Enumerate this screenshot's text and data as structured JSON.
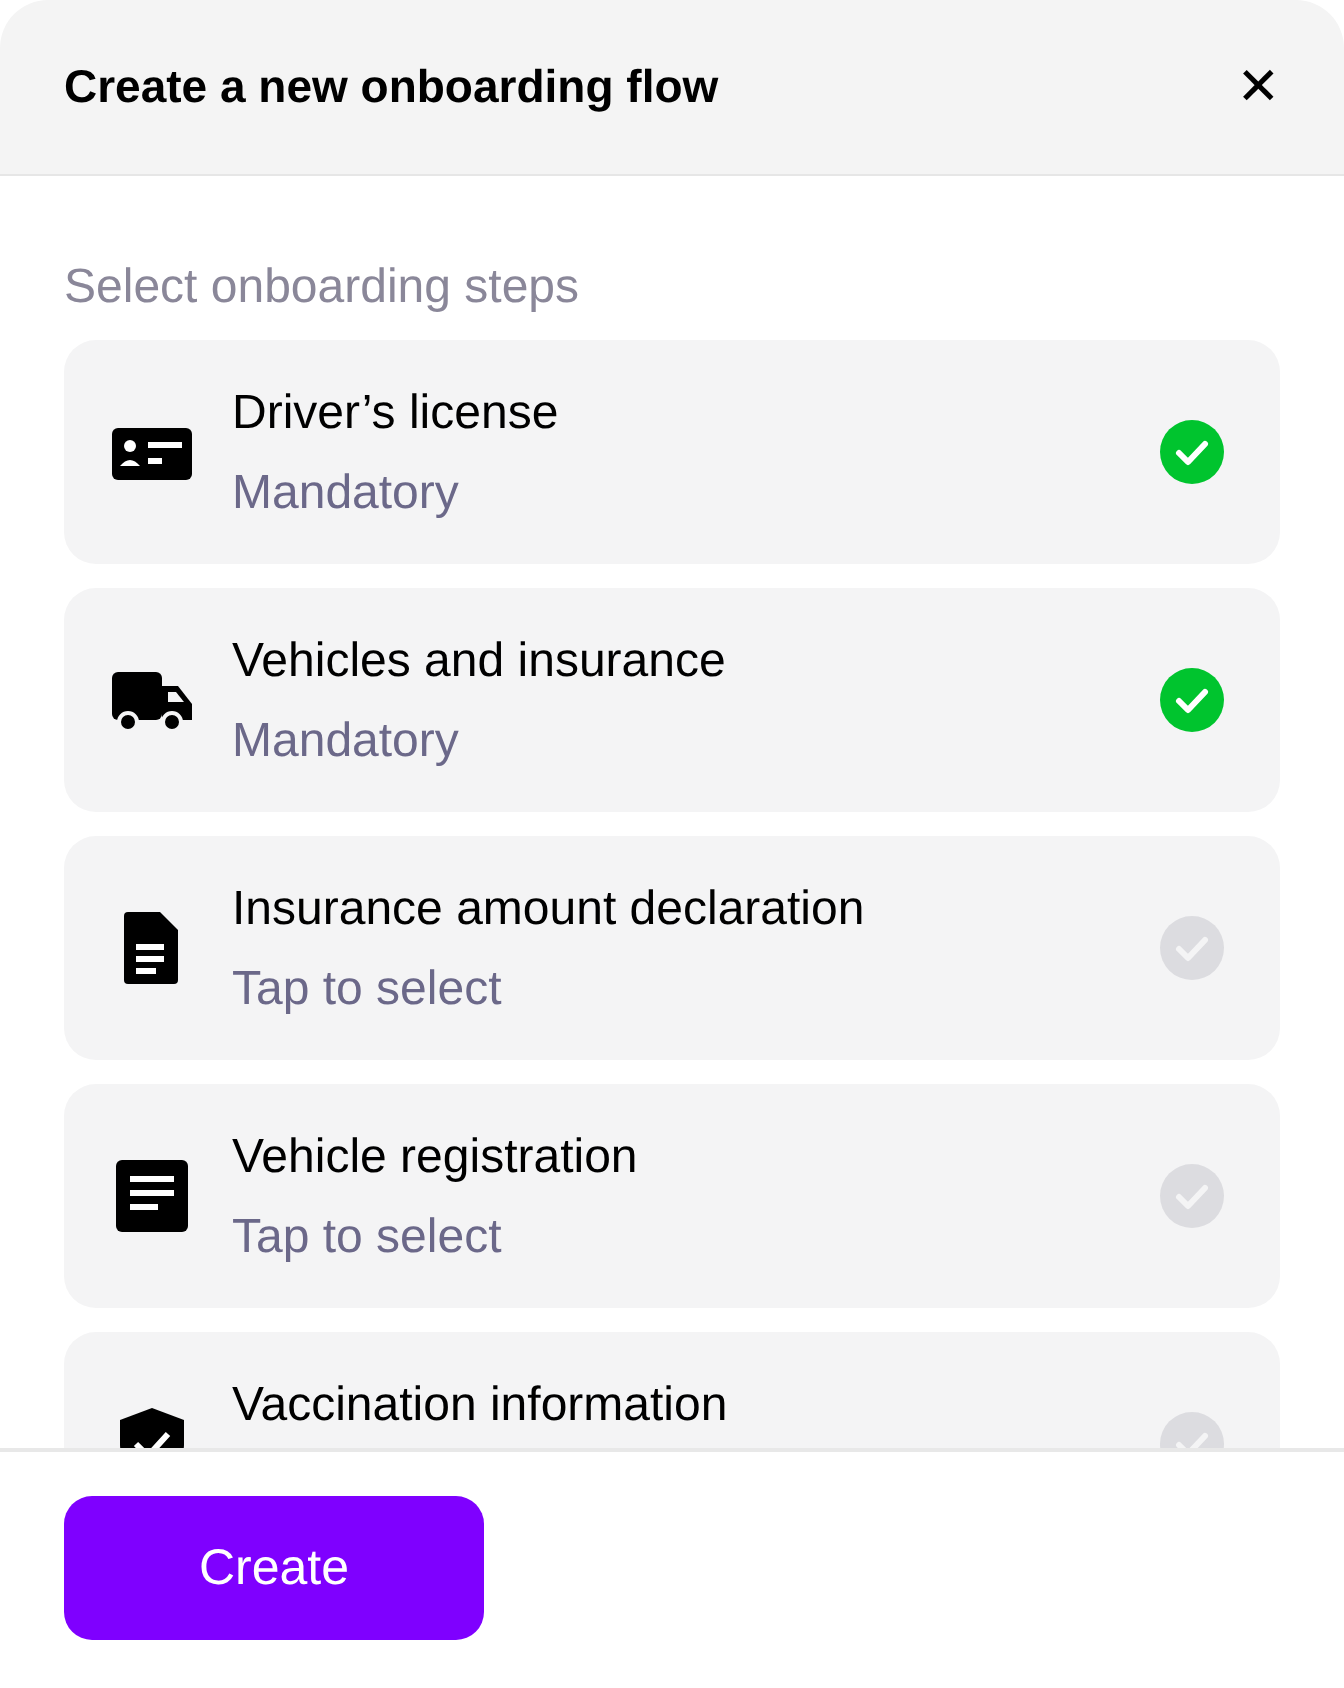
{
  "dialog": {
    "title": "Create a new onboarding flow",
    "close": "✕"
  },
  "section_label": "Select onboarding steps",
  "steps": [
    {
      "kind": "id-card",
      "title": "Driver’s license",
      "subtitle": "Mandatory",
      "selected": true
    },
    {
      "kind": "truck",
      "title": "Vehicles and insurance",
      "subtitle": "Mandatory",
      "selected": true
    },
    {
      "kind": "document",
      "title": "Insurance amount declaration",
      "subtitle": "Tap to select",
      "selected": false
    },
    {
      "kind": "form",
      "title": "Vehicle registration",
      "subtitle": "Tap to select",
      "selected": false
    },
    {
      "kind": "shield",
      "title": "Vaccination information",
      "selected": false
    }
  ],
  "buttons": [
    "Create"
  ]
}
